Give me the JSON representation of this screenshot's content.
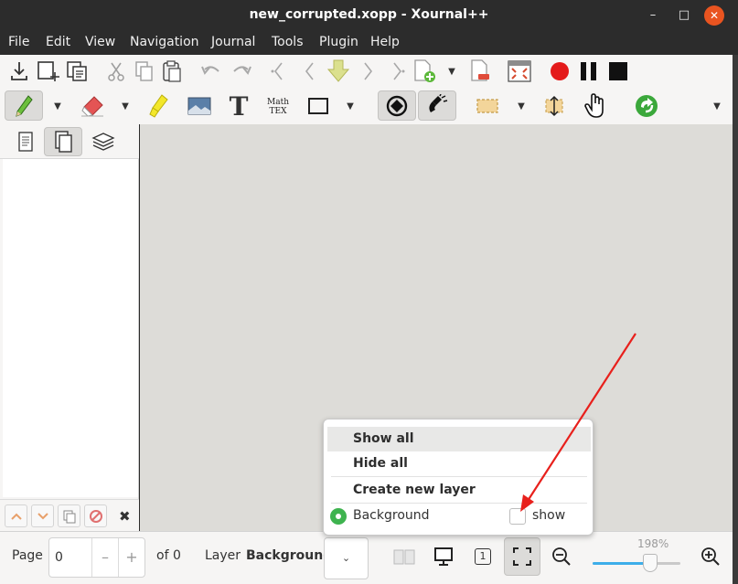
{
  "window": {
    "title": "new_corrupted.xopp - Xournal++",
    "min_glyph": "–",
    "max_glyph": "□",
    "close_glyph": "✕"
  },
  "menubar": {
    "items": [
      "File",
      "Edit",
      "View",
      "Navigation",
      "Journal",
      "Tools",
      "Plugin",
      "Help"
    ]
  },
  "toolbar1": {
    "icons": [
      "save-icon",
      "new-page-icon",
      "copy-pages-icon",
      "cut-icon",
      "copy-icon",
      "paste-icon",
      "undo-icon",
      "redo-icon",
      "first-page-icon",
      "previous-page-icon",
      "goto-page-icon",
      "next-page-icon",
      "last-page-icon",
      "insert-page-icon",
      "delete-page-icon",
      "fullscreen-icon",
      "record-icon",
      "pause-icon",
      "stop-icon"
    ]
  },
  "toolbar2": {
    "icons": [
      "pen-icon",
      "eraser-icon",
      "highlighter-icon",
      "image-icon",
      "text-icon",
      "math-tex-icon",
      "rectangle-icon",
      "rotation-snap-icon",
      "grid-snap-icon",
      "select-rect-icon",
      "vertical-space-icon",
      "hand-icon",
      "refresh-icon"
    ],
    "text_tool_glyph": "T",
    "math_line1": "Math",
    "math_line2": "TEX"
  },
  "sidebar": {
    "tabs": [
      "page-preview-icon",
      "pages-icon",
      "layers-icon"
    ],
    "bottom_buttons": [
      "move-up-icon",
      "move-down-icon",
      "copy-layer-icon",
      "delete-layer-icon"
    ],
    "close_glyph": "✖"
  },
  "popover": {
    "items": [
      "Show all",
      "Hide all",
      "Create new layer"
    ],
    "layer_name": "Background",
    "show_label": "show",
    "show_checked": false
  },
  "statusbar": {
    "page_label": "Page",
    "page_value": "0",
    "minus": "–",
    "plus": "+",
    "of_label": "of 0",
    "layer_label": "Layer",
    "layer_value": "Background",
    "dropdown_glyph": "⌄",
    "single_page_glyph": "1",
    "zoom_value": "198%",
    "zoom_fraction": 0.66
  },
  "colors": {
    "accent": "#e95420",
    "record": "#e02020",
    "radio": "#3eb34f",
    "annotation_arrow": "#e8201c",
    "zoom_fill": "#3daee9"
  }
}
